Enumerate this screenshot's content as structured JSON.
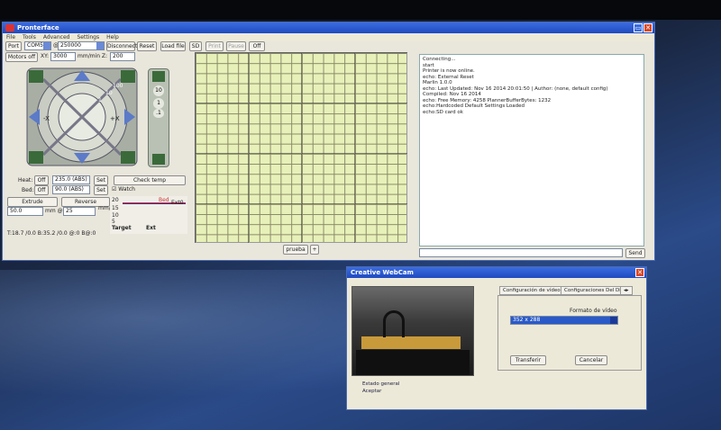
{
  "main_window": {
    "title": "Pronterface",
    "menu": [
      "File",
      "Tools",
      "Advanced",
      "Settings",
      "Help"
    ],
    "toolbar": {
      "port_label": "Port",
      "port_value": "COM5",
      "at_label": "@",
      "baud_value": "250000",
      "disconnect_label": "Disconnect",
      "reset_label": "Reset",
      "loadfile_label": "Load file",
      "sd_label": "SD",
      "print_label": "Print",
      "pause_label": "Pause",
      "off_label": "Off"
    },
    "motors": {
      "motors_off_label": "Motors off",
      "xy_label": "XY:",
      "xy_value": "3000",
      "z_label": "mm/min Z:",
      "z_value": "200"
    },
    "jog": {
      "home_xy_label": "⌂",
      "y_plus": "+Y",
      "y_minus": "-Y",
      "x_plus": "+X",
      "x_minus": "-X",
      "ring_100": "100",
      "ring_10": "10",
      "ring_1": "1",
      "ring_01": ".1"
    },
    "zbar": {
      "ring_10": "10",
      "ring_1": "1",
      "ring_01": ".1"
    },
    "temps": {
      "heat_label": "Heat:",
      "heat_off": "Off",
      "heat_value": "235.0 (ABS)",
      "heat_set": "Set",
      "bed_label": "Bed:",
      "bed_off": "Off",
      "bed_value": "90.0 (ABS)",
      "bed_set": "Set",
      "check_temps": "Check temp",
      "watch_label": "Watch"
    },
    "extrude": {
      "extrude_label": "Extrude",
      "reverse_label": "Reverse",
      "length_value": "50.0",
      "mm_at": "mm @",
      "speed_value": "25",
      "units": "mm/min",
      "graph_labels": [
        "20",
        "15",
        "10",
        "5"
      ],
      "target_label": "Target",
      "ext_label": "Ext",
      "ext0_label": "Ext0",
      "bed_graph_label": "Bed"
    },
    "status_line": "T:18.7 /0.0 B:35.2 /0.0 @:0 B@:0",
    "bottom_buttons": {
      "send_label": "prueba",
      "plus_label": "+",
      "send_console_label": "Send"
    },
    "console_lines": [
      "Connecting...",
      "start",
      "Printer is now online.",
      "echo: External Reset",
      "Marlin 1.0.0",
      "echo: Last Updated: Nov 16 2014 20:01:50 | Author: (none, default config)",
      "Compiled: Nov 16 2014",
      "echo: Free Memory: 4258  PlannerBufferBytes: 1232",
      "echo:Hardcoded Default Settings Loaded",
      "echo:SD card ok"
    ]
  },
  "webcam_window": {
    "title": "Creative WebCam",
    "tab_video": "Configuración de vídeo",
    "tab_device": "Configuraciones Del Dis",
    "format_label": "Formato de vídeo",
    "format_value": "352 x 288",
    "transfer_label": "Transferir",
    "cancel_label": "Cancelar",
    "status_general": "Estado general",
    "status_accept": "Aceptar"
  }
}
